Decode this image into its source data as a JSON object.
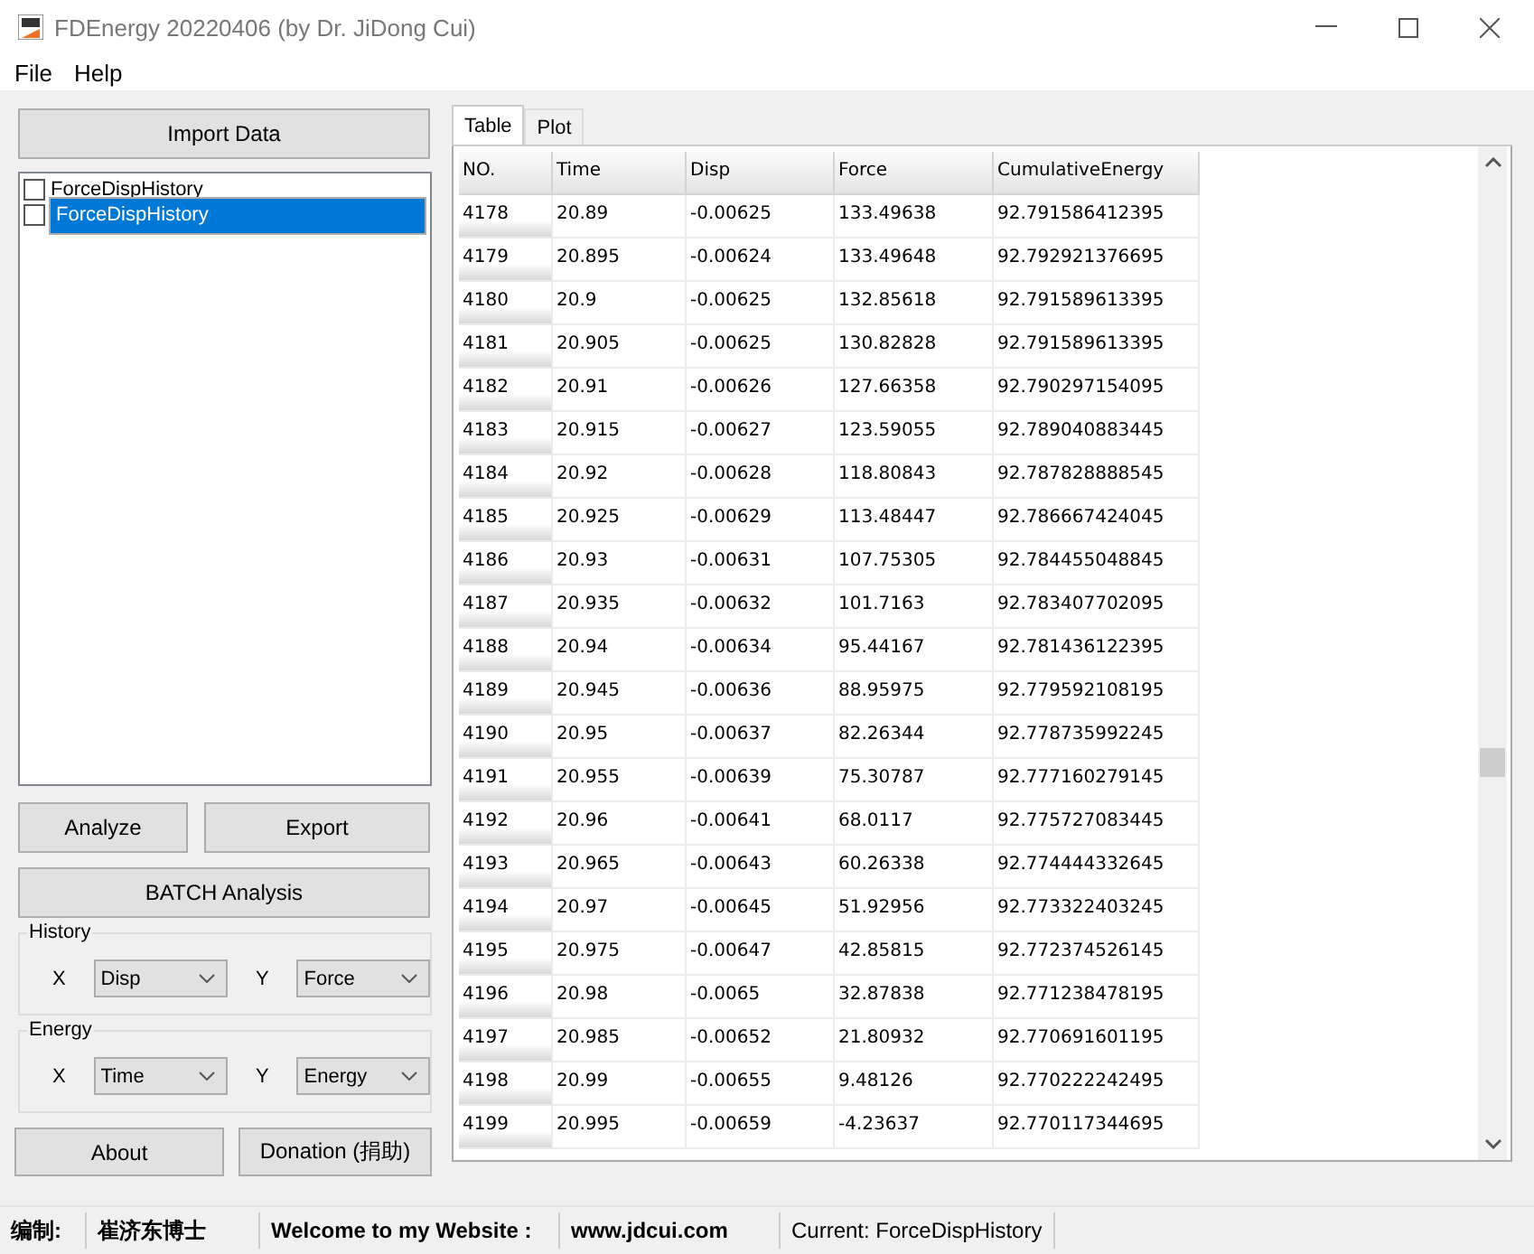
{
  "window": {
    "title": "FDEnergy 20220406 (by Dr. JiDong Cui)"
  },
  "menu": [
    "File",
    "Help"
  ],
  "import_button": "Import Data",
  "file_list": [
    {
      "label": "ForceDispHistory",
      "checked": false,
      "selected": false
    },
    {
      "label": "ForceDispHistory",
      "checked": false,
      "selected": true
    }
  ],
  "action_buttons": [
    "Analyze",
    "Export"
  ],
  "batch_button": "BATCH Analysis",
  "groups": [
    {
      "title": "History",
      "x_label": "X",
      "x_value": "Disp",
      "y_label": "Y",
      "y_value": "Force"
    },
    {
      "title": "Energy",
      "x_label": "X",
      "x_value": "Time",
      "y_label": "Y",
      "y_value": "Energy"
    }
  ],
  "bottom_buttons": [
    "About",
    "Donation (捐助)"
  ],
  "tabs": [
    {
      "label": "Table",
      "selected": true
    },
    {
      "label": "Plot",
      "selected": false
    }
  ],
  "table": {
    "columns": [
      "NO.",
      "Time",
      "Disp",
      "Force",
      "CumulativeEnergy"
    ],
    "rows": [
      [
        "4178",
        "20.89",
        "-0.00625",
        "133.49638",
        "92.791586412395"
      ],
      [
        "4179",
        "20.895",
        "-0.00624",
        "133.49648",
        "92.792921376695"
      ],
      [
        "4180",
        "20.9",
        "-0.00625",
        "132.85618",
        "92.791589613395"
      ],
      [
        "4181",
        "20.905",
        "-0.00625",
        "130.82828",
        "92.791589613395"
      ],
      [
        "4182",
        "20.91",
        "-0.00626",
        "127.66358",
        "92.790297154095"
      ],
      [
        "4183",
        "20.915",
        "-0.00627",
        "123.59055",
        "92.789040883445"
      ],
      [
        "4184",
        "20.92",
        "-0.00628",
        "118.80843",
        "92.787828888545"
      ],
      [
        "4185",
        "20.925",
        "-0.00629",
        "113.48447",
        "92.786667424045"
      ],
      [
        "4186",
        "20.93",
        "-0.00631",
        "107.75305",
        "92.784455048845"
      ],
      [
        "4187",
        "20.935",
        "-0.00632",
        "101.7163",
        "92.783407702095"
      ],
      [
        "4188",
        "20.94",
        "-0.00634",
        "95.44167",
        "92.781436122395"
      ],
      [
        "4189",
        "20.945",
        "-0.00636",
        "88.95975",
        "92.779592108195"
      ],
      [
        "4190",
        "20.95",
        "-0.00637",
        "82.26344",
        "92.778735992245"
      ],
      [
        "4191",
        "20.955",
        "-0.00639",
        "75.30787",
        "92.777160279145"
      ],
      [
        "4192",
        "20.96",
        "-0.00641",
        "68.0117",
        "92.775727083445"
      ],
      [
        "4193",
        "20.965",
        "-0.00643",
        "60.26338",
        "92.774444332645"
      ],
      [
        "4194",
        "20.97",
        "-0.00645",
        "51.92956",
        "92.773322403245"
      ],
      [
        "4195",
        "20.975",
        "-0.00647",
        "42.85815",
        "92.772374526145"
      ],
      [
        "4196",
        "20.98",
        "-0.0065",
        "32.87838",
        "92.771238478195"
      ],
      [
        "4197",
        "20.985",
        "-0.00652",
        "21.80932",
        "92.770691601195"
      ],
      [
        "4198",
        "20.99",
        "-0.00655",
        "9.48126",
        "92.770222242495"
      ],
      [
        "4199",
        "20.995",
        "-0.00659",
        "-4.23637",
        "92.770117344695"
      ]
    ]
  },
  "status_bar": [
    {
      "text": "编制:",
      "bold": true
    },
    {
      "text": "崔济东博士",
      "bold": true
    },
    {
      "text": "Welcome to my Website :",
      "bold": true
    },
    {
      "text": "www.jdcui.com",
      "bold": true
    },
    {
      "text": "Current: ForceDispHistory",
      "bold": false
    }
  ]
}
